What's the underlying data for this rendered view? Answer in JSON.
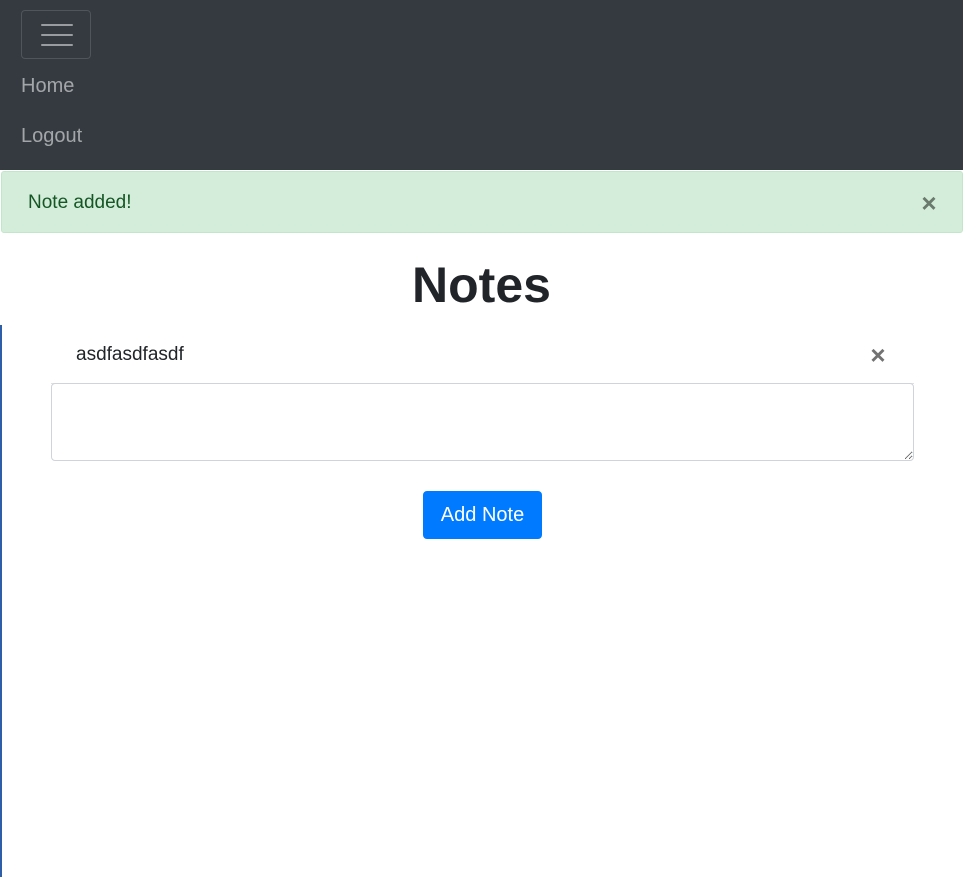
{
  "navbar": {
    "toggler_icon": "hamburger-menu-icon",
    "links": [
      {
        "label": "Home"
      },
      {
        "label": "Logout"
      }
    ]
  },
  "alert": {
    "message": "Note added!",
    "close_symbol": "×",
    "close_icon": "close-icon",
    "color_background": "#d4edda",
    "color_text": "#155724"
  },
  "main": {
    "title": "Notes",
    "notes": [
      {
        "text": "asdfasdfasdf",
        "delete_symbol": "×"
      }
    ],
    "input": {
      "value": "",
      "placeholder": ""
    },
    "add_button_label": "Add Note",
    "accent_color": "#007bff"
  }
}
